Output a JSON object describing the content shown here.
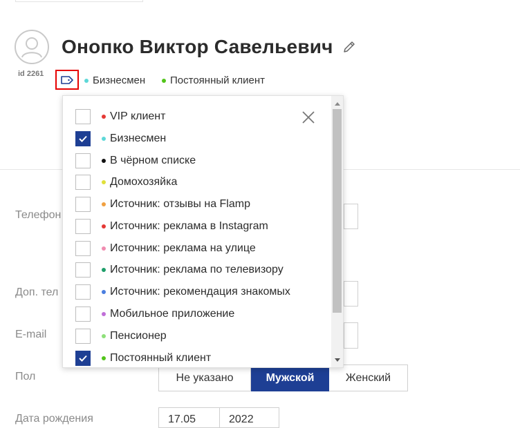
{
  "client": {
    "name": "Онопко Виктор Савельевич",
    "id": "id 2261",
    "tags": [
      {
        "label": "Бизнесмен",
        "color": "#5ed8d8"
      },
      {
        "label": "Постоянный клиент",
        "color": "#52c41a"
      }
    ]
  },
  "form": {
    "phone_label": "Телефон",
    "extra_phone_label": "Доп. тел",
    "email_label": "E-mail",
    "gender_label": "Пол",
    "gender_options": [
      "Не указано",
      "Мужской",
      "Женский"
    ],
    "gender_selected": "Мужской",
    "birthday_label": "Дата рождения",
    "birthday_day_month": "17.05",
    "birthday_year": "2022"
  },
  "tag_dropdown": {
    "options": [
      {
        "label": "VIP клиент",
        "color": "#e53935",
        "checked": false
      },
      {
        "label": "Бизнесмен",
        "color": "#5ed8d8",
        "checked": true
      },
      {
        "label": "В чёрном списке",
        "color": "#111111",
        "checked": false
      },
      {
        "label": "Домохозяйка",
        "color": "#e0e03a",
        "checked": false
      },
      {
        "label": "Источник: отзывы на Flamp",
        "color": "#f0a040",
        "checked": false
      },
      {
        "label": "Источник: реклама в Instagram",
        "color": "#e53935",
        "checked": false
      },
      {
        "label": "Источник: реклама на улице",
        "color": "#f08cb0",
        "checked": false
      },
      {
        "label": "Источник: реклама по телевизору",
        "color": "#1e9e6a",
        "checked": false
      },
      {
        "label": "Источник: рекомендация знакомых",
        "color": "#4a7ee0",
        "checked": false
      },
      {
        "label": "Мобильное приложение",
        "color": "#c06fd8",
        "checked": false
      },
      {
        "label": "Пенсионер",
        "color": "#8ee07a",
        "checked": false
      },
      {
        "label": "Постоянный клиент",
        "color": "#52c41a",
        "checked": true
      }
    ]
  },
  "icons": {
    "avatar": "user-avatar-icon",
    "edit": "pencil-icon",
    "tag": "tag-icon",
    "close": "close-icon",
    "checkmark": "checkmark-icon"
  },
  "colors": {
    "accent": "#1e3f94",
    "highlight_border": "#e60000"
  }
}
